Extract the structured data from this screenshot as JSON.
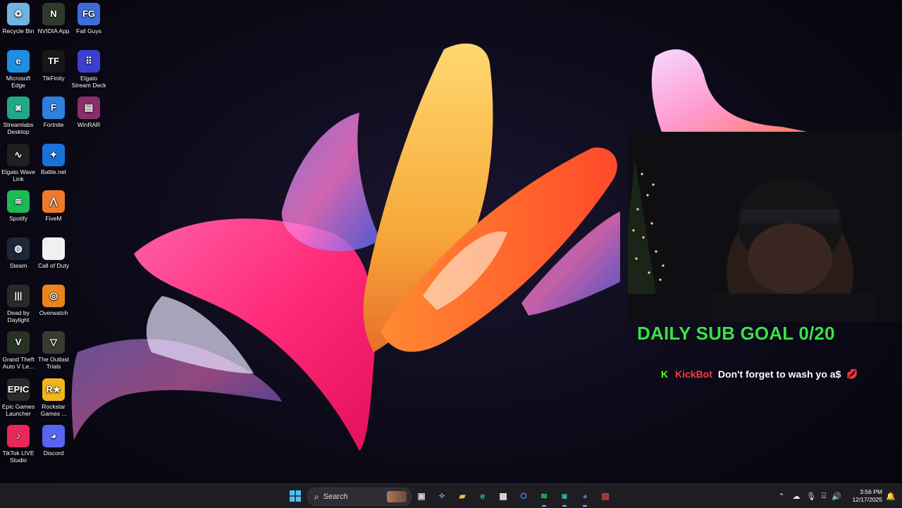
{
  "desktop": {
    "icons": [
      {
        "label": "Recycle Bin",
        "glyph": "♻",
        "icon": "recycle-bin-icon"
      },
      {
        "label": "NVIDIA App",
        "glyph": "N",
        "icon": "nvidia-icon"
      },
      {
        "label": "Fall Guys",
        "glyph": "FG",
        "icon": "fall-guys-icon"
      },
      {
        "label": "Microsoft Edge",
        "glyph": "e",
        "icon": "edge-icon"
      },
      {
        "label": "TikFinity",
        "glyph": "TF",
        "icon": "tikfinity-icon"
      },
      {
        "label": "Elgato Stream Deck",
        "glyph": "⠿",
        "icon": "stream-deck-icon"
      },
      {
        "label": "Streamlabs Desktop",
        "glyph": "◙",
        "icon": "streamlabs-icon"
      },
      {
        "label": "Fortnite",
        "glyph": "F",
        "icon": "fortnite-icon"
      },
      {
        "label": "WinRAR",
        "glyph": "▤",
        "icon": "winrar-icon"
      },
      {
        "label": "Elgato Wave Link",
        "glyph": "∿",
        "icon": "wave-link-icon"
      },
      {
        "label": "Battle.net",
        "glyph": "✦",
        "icon": "battlenet-icon"
      },
      {
        "label": "Spotify",
        "glyph": "≋",
        "icon": "spotify-icon"
      },
      {
        "label": "FiveM",
        "glyph": "⋀",
        "icon": "fivem-icon"
      },
      {
        "label": "Steam",
        "glyph": "◍",
        "icon": "steam-icon"
      },
      {
        "label": "Call of Duty",
        "glyph": "",
        "icon": "file-icon"
      },
      {
        "label": "Dead by Daylight",
        "glyph": "|||",
        "icon": "dead-by-daylight-icon"
      },
      {
        "label": "Overwatch",
        "glyph": "◎",
        "icon": "overwatch-icon"
      },
      {
        "label": "Grand Theft Auto V Le...",
        "glyph": "V",
        "icon": "gta-icon"
      },
      {
        "label": "The Outlast Trials",
        "glyph": "▽",
        "icon": "outlast-icon"
      },
      {
        "label": "Epic Games Launcher",
        "glyph": "EPIC",
        "icon": "epic-games-icon"
      },
      {
        "label": "Rockstar Games ...",
        "glyph": "R★",
        "icon": "rockstar-icon"
      },
      {
        "label": "TikTok LIVE Studio",
        "glyph": "♪",
        "icon": "tiktok-icon"
      },
      {
        "label": "Discord",
        "glyph": "◕",
        "icon": "discord-icon"
      }
    ]
  },
  "overlay": {
    "sub_goal": "DAILY SUB GOAL 0/20",
    "chat": {
      "platform_glyph": "K",
      "username": "KickBot",
      "message": "Don't forget to wash yo a$",
      "emote": "💋"
    }
  },
  "taskbar": {
    "search_placeholder": "Search",
    "clock_time": "3:56 PM",
    "clock_date": "12/17/2025",
    "pinned": [
      {
        "icon": "task-view-icon",
        "glyph": "▣",
        "color": "#cfcfd6"
      },
      {
        "icon": "copilot-icon",
        "glyph": "✧",
        "color": "#7aa7ff"
      },
      {
        "icon": "file-explorer-icon",
        "glyph": "▰",
        "color": "#f2c14e"
      },
      {
        "icon": "edge-icon",
        "glyph": "e",
        "color": "#35c3b5"
      },
      {
        "icon": "microsoft-store-icon",
        "glyph": "▦",
        "color": "#e6e6e6"
      },
      {
        "icon": "outlook-icon",
        "glyph": "O",
        "color": "#2f7fe0"
      },
      {
        "icon": "spotify-icon",
        "glyph": "≋",
        "color": "#1ed760"
      },
      {
        "icon": "streamlabs-icon",
        "glyph": "◙",
        "color": "#31c3a2"
      },
      {
        "icon": "discord-icon",
        "glyph": "◕",
        "color": "#6b79ff"
      },
      {
        "icon": "winrar-icon",
        "glyph": "▤",
        "color": "#c94a4a"
      }
    ]
  },
  "colors": {
    "goal_green": "#38e24a",
    "chat_user_red": "#ff3a3a",
    "kick_green": "#53fc18"
  }
}
